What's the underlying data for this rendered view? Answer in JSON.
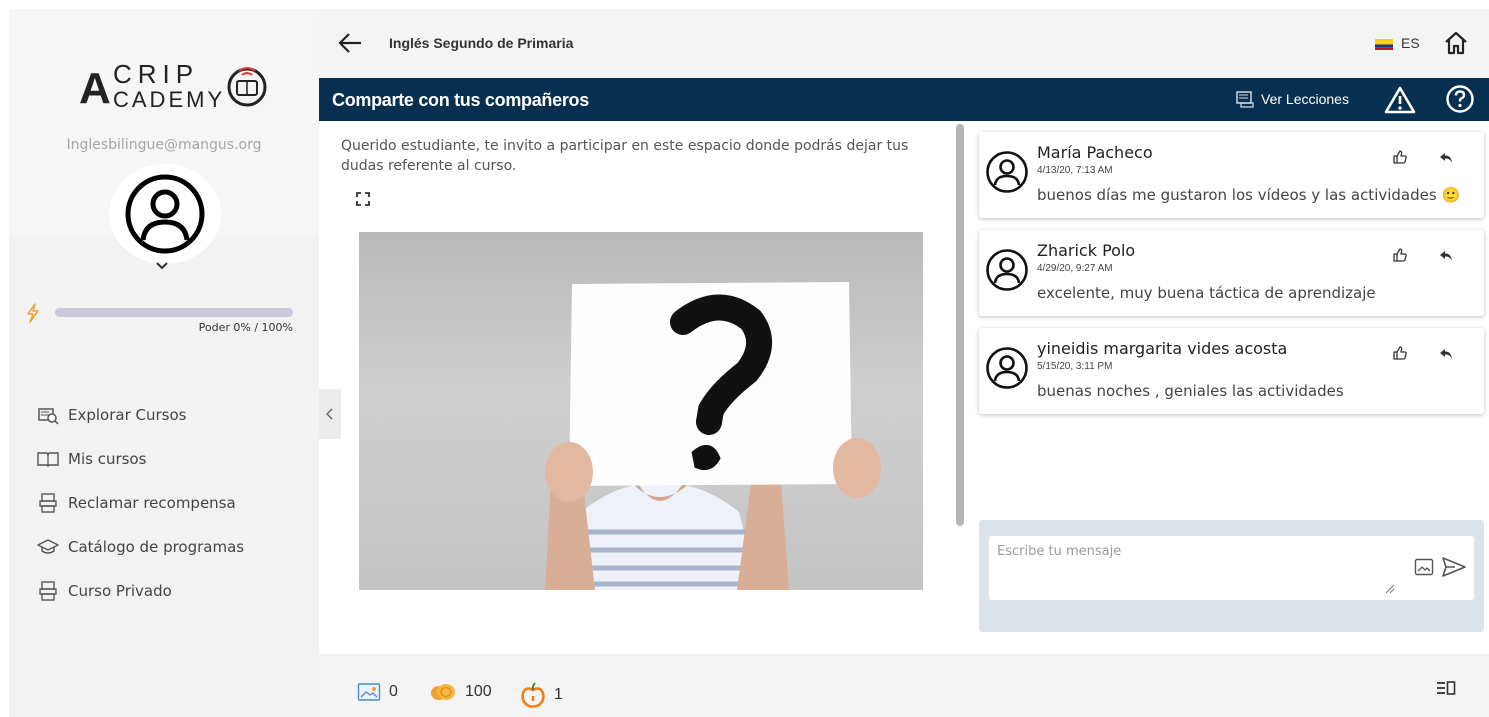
{
  "sidebar": {
    "logo_text": "ACRIP ACADEMY",
    "email": "Inglesbilingue@mangus.org",
    "power": {
      "label": "Poder 0% / 100%",
      "percent": 0
    },
    "items": [
      {
        "label": "Explorar Cursos",
        "icon": "explore-courses-icon"
      },
      {
        "label": "Mis cursos",
        "icon": "book-icon"
      },
      {
        "label": "Reclamar recompensa",
        "icon": "reward-icon"
      },
      {
        "label": "Catálogo de programas",
        "icon": "graduation-cap-icon"
      },
      {
        "label": "Curso Privado",
        "icon": "private-course-icon"
      }
    ]
  },
  "header": {
    "course_title": "Inglés Segundo de Primaria",
    "language": "ES"
  },
  "forum": {
    "title": "Comparte con tus compañeros",
    "lessons_button": "Ver Lecciones",
    "intro": "Querido estudiante, te invito a participar en este espacio donde podrás dejar tus dudas referente al curso."
  },
  "comments": [
    {
      "author": "María Pacheco",
      "date": "4/13/20, 7:13 AM",
      "text": "buenos días me gustaron los vídeos y las actividades 🙂"
    },
    {
      "author": "Zharick Polo",
      "date": "4/29/20, 9:27 AM",
      "text": "excelente, muy buena táctica de aprendizaje"
    },
    {
      "author": "yineidis margarita vides acosta",
      "date": "5/15/20, 3:11 PM",
      "text": "buenas noches , geniales las actividades"
    }
  ],
  "compose": {
    "placeholder": "Escribe tu mensaje"
  },
  "footer": {
    "stats": [
      {
        "icon": "image-points-icon",
        "value": "0"
      },
      {
        "icon": "coins-icon",
        "value": "100"
      },
      {
        "icon": "apple-icon",
        "value": "1"
      }
    ]
  },
  "colors": {
    "navy": "#073050",
    "accent_orange": "#f0a030",
    "power_bar": "#c9c9d9"
  }
}
